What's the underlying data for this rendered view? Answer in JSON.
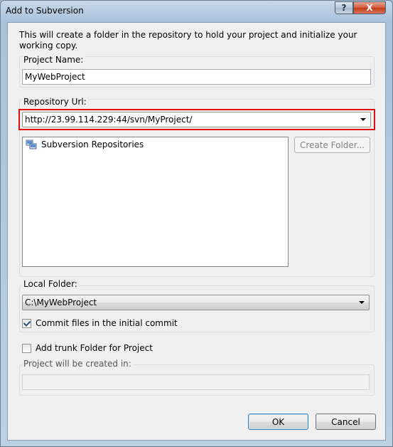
{
  "window": {
    "title": "Add to Subversion",
    "help_glyph": "?",
    "close_glyph": "X"
  },
  "description": "This will create a folder in the repository to hold your project and initialize your working copy.",
  "project_name": {
    "label": "Project Name:",
    "value": "MyWebProject"
  },
  "repository": {
    "label": "Repository Url:",
    "url": "http://23.99.114.229:44/svn/MyProject/",
    "tree_root": "Subversion Repositories",
    "create_folder_button": "Create Folder...",
    "highlight_color": "#e01010"
  },
  "local_folder": {
    "label": "Local Folder:",
    "value": "C:\\MyWebProject",
    "commit_label": "Commit files in the initial commit",
    "commit_checked": true
  },
  "trunk": {
    "label": "Add trunk Folder for Project",
    "checked": false
  },
  "created_in": {
    "label": "Project will be created in:",
    "value": ""
  },
  "buttons": {
    "ok": "OK",
    "cancel": "Cancel"
  }
}
